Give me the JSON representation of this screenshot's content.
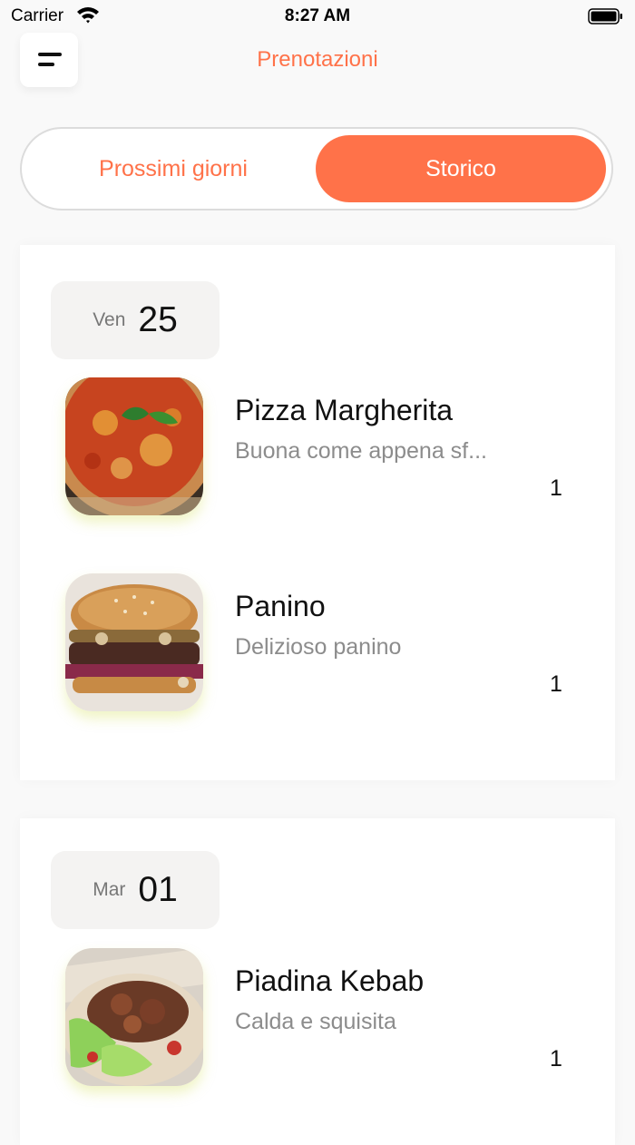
{
  "status_bar": {
    "carrier": "Carrier",
    "time": "8:27 AM"
  },
  "nav": {
    "title": "Prenotazioni",
    "menu_icon": "menu-icon"
  },
  "segments": {
    "upcoming": "Prossimi giorni",
    "history": "Storico",
    "selected": "history"
  },
  "colors": {
    "accent": "#ff7249",
    "background": "#f9f9f9",
    "date_box": "#f4f3f2",
    "subtitle": "#8c8c8c"
  },
  "reservations": [
    {
      "weekday": "Ven",
      "day": "25",
      "items": [
        {
          "name": "Pizza Margherita",
          "description": "Buona come appena sf...",
          "quantity": "1",
          "image": "pizza-image"
        },
        {
          "name": "Panino",
          "description": "Delizioso panino",
          "quantity": "1",
          "image": "burger-image"
        }
      ]
    },
    {
      "weekday": "Mar",
      "day": "01",
      "items": [
        {
          "name": "Piadina Kebab",
          "description": "Calda e squisita",
          "quantity": "1",
          "image": "kebab-image"
        }
      ]
    }
  ]
}
